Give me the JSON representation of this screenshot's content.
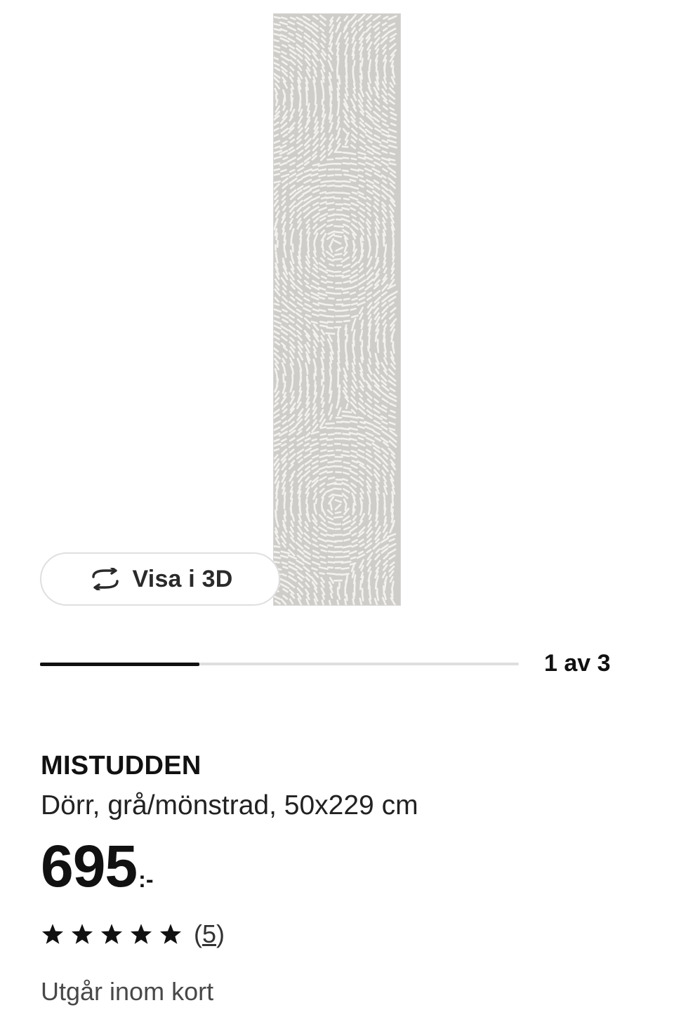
{
  "gallery": {
    "view3d_label": "Visa i 3D",
    "view3d_icon": "rotate-3d-icon",
    "counter": "1 av 3",
    "progress_fraction": 0.333,
    "image_background": "#cfcdca"
  },
  "product": {
    "name": "MISTUDDEN",
    "description": "Dörr, grå/mönstrad, 50x229 cm",
    "price_integer": "695",
    "price_suffix": ":-",
    "rating_stars": 5,
    "rating_max": 5,
    "reviews_open": "(",
    "reviews_count": "5",
    "reviews_close": ")",
    "availability": "Utgår inom kort"
  },
  "colors": {
    "text": "#111111",
    "muted": "#484848",
    "border": "#dfdfdf"
  }
}
